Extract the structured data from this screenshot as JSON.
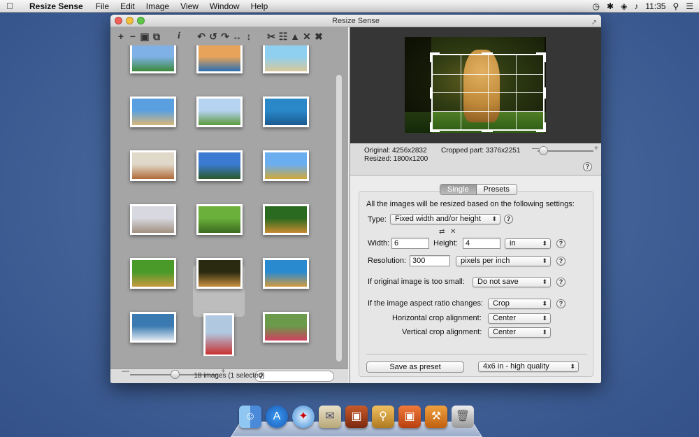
{
  "menubar": {
    "apple_icon": "apple-icon",
    "app_name": "Resize Sense",
    "menus": [
      "File",
      "Edit",
      "Image",
      "View",
      "Window",
      "Help"
    ],
    "clock": "11:35"
  },
  "window": {
    "title": "Resize Sense"
  },
  "toolbar_icons": [
    "add",
    "remove",
    "save",
    "save-all",
    "info",
    "rotate-left",
    "rotate-left-alt",
    "rotate-right",
    "flip-horizontal",
    "flip-vertical",
    "crop",
    "crop-alt",
    "crop-auto",
    "clear",
    "clear-all"
  ],
  "thumbnails": [
    {
      "name": "windmill",
      "c1": "#7fb1e6",
      "c2": "#3a8a3a"
    },
    {
      "name": "lake-trees",
      "c1": "#e8a35a",
      "c2": "#2a6fb0"
    },
    {
      "name": "sea-cliffs",
      "c1": "#8fd0f0",
      "c2": "#d8c89a"
    },
    {
      "name": "beach",
      "c1": "#5aa0e0",
      "c2": "#d9b77a"
    },
    {
      "name": "river-path",
      "c1": "#b7d3f2",
      "c2": "#5a9a3a"
    },
    {
      "name": "rock-arch",
      "c1": "#2a88c8",
      "c2": "#1a5a90"
    },
    {
      "name": "autumn-lake",
      "c1": "#e0d8c8",
      "c2": "#b06a38"
    },
    {
      "name": "harbor",
      "c1": "#3a7ad0",
      "c2": "#2a5a2a"
    },
    {
      "name": "castle",
      "c1": "#6aaef0",
      "c2": "#d0a838"
    },
    {
      "name": "town-square",
      "c1": "#d8d8e0",
      "c2": "#a09080"
    },
    {
      "name": "forest-log",
      "c1": "#6ab03a",
      "c2": "#3a6a20"
    },
    {
      "name": "tiger",
      "c1": "#2a6a20",
      "c2": "#c88a30"
    },
    {
      "name": "lion-grass",
      "c1": "#4a9a2a",
      "c2": "#c89a40"
    },
    {
      "name": "cheetah",
      "c1": "#2a2a10",
      "c2": "#c89040"
    },
    {
      "name": "giraffe",
      "c1": "#2a8ad0",
      "c2": "#d09a40"
    },
    {
      "name": "heron",
      "c1": "#3a7ab0",
      "c2": "#e0e8f0"
    },
    {
      "name": "boy-running",
      "c1": "#b0c8e0",
      "c2": "#c83030"
    },
    {
      "name": "girl-meadow",
      "c1": "#6a9a4a",
      "c2": "#d04060"
    }
  ],
  "library_status": "18 images (1 selected)",
  "preview": {
    "original": "Original: 4256x2832",
    "cropped": "Cropped part: 3376x2251",
    "resized": "Resized: 1800x1200"
  },
  "tabs": [
    "Single",
    "Presets"
  ],
  "settings": {
    "intro": "All the images will be resized based on the following settings:",
    "type_label": "Type:",
    "type_value": "Fixed width and/or height",
    "width_label": "Width:",
    "width_value": "6",
    "height_label": "Height:",
    "height_value": "4",
    "unit_value": "in",
    "resolution_label": "Resolution:",
    "resolution_value": "300",
    "resolution_unit": "pixels per inch",
    "too_small_label": "If original image is too small:",
    "too_small_value": "Do not save",
    "aspect_label": "If the image aspect ratio changes:",
    "aspect_value": "Crop",
    "h_align_label": "Horizontal crop alignment:",
    "h_align_value": "Center",
    "v_align_label": "Vertical crop alignment:",
    "v_align_value": "Center",
    "save_preset": "Save as preset",
    "preset_value": "4x6 in - high quality",
    "help": "?"
  },
  "dock": [
    "finder",
    "app-store",
    "safari",
    "mail",
    "photo-booth",
    "preview",
    "resize-sense",
    "tools",
    "trash"
  ]
}
